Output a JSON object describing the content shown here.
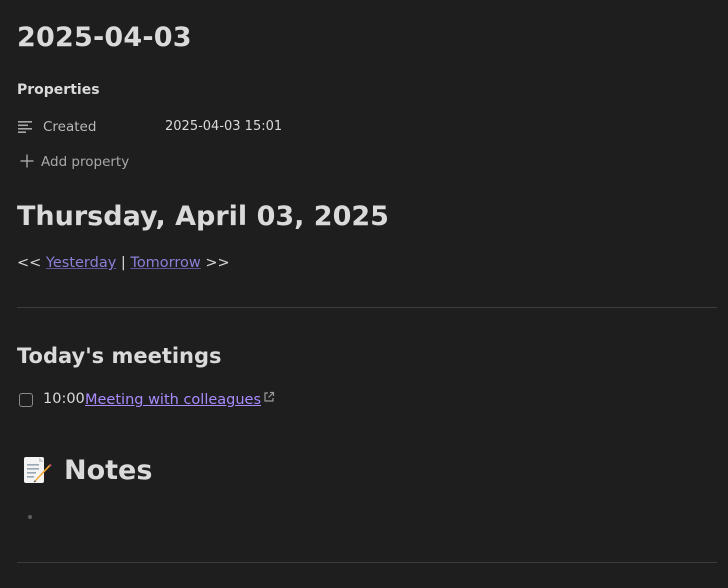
{
  "note": {
    "title": "2025-04-03"
  },
  "properties": {
    "heading": "Properties",
    "items": [
      {
        "key": "Created",
        "value": "2025-04-03 15:01",
        "icon": "text-lines-icon"
      }
    ],
    "add_label": "Add property"
  },
  "daily": {
    "heading": "Thursday, April 03, 2025",
    "nav_prefix": "<< ",
    "yesterday_label": "Yesterday",
    "separator": " | ",
    "tomorrow_label": "Tomorrow",
    "nav_suffix": " >>"
  },
  "meetings": {
    "heading": "Today's meetings",
    "items": [
      {
        "time": "10:00",
        "title": "Meeting with colleagues",
        "checked": false
      }
    ]
  },
  "notes": {
    "emoji": "memo",
    "heading": "Notes"
  },
  "colors": {
    "background": "#1e1e1e",
    "text": "#dadada",
    "internal_link": "#8a7fd8",
    "external_link": "#a98bff",
    "divider": "#3c3c3c"
  }
}
